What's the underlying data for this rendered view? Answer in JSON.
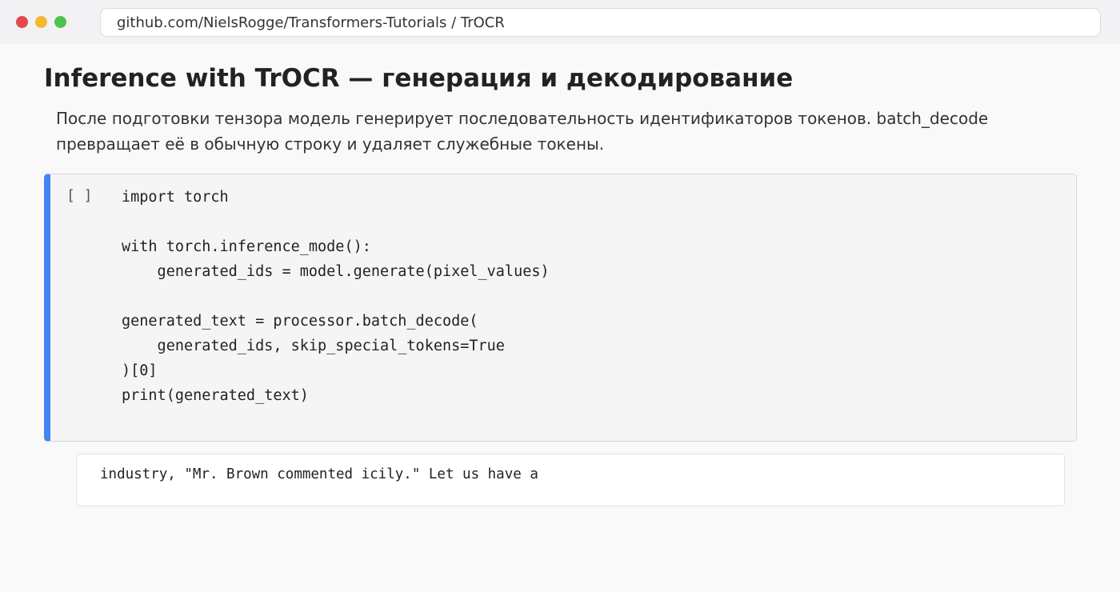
{
  "window": {
    "url": "github.com/NielsRogge/Transformers-Tutorials / TrOCR",
    "controls": [
      "close",
      "minimize",
      "maximize"
    ]
  },
  "notebook": {
    "title": "Inference with TrOCR — генерация и декодирование",
    "description": "После подготовки тензора модель генерирует последовательность идентификаторов токенов. batch_decode превращает её в обычную строку и удаляет служебные токены.",
    "cell": {
      "prompt": "[ ]",
      "code": [
        "import torch",
        "",
        "with torch.inference_mode():",
        "    generated_ids = model.generate(pixel_values)",
        "",
        "generated_text = processor.batch_decode(",
        "    generated_ids, skip_special_tokens=True",
        ")[0]",
        "print(generated_text)"
      ]
    },
    "output": "industry, \"Mr. Brown commented icily.\" Let us have a"
  },
  "colors": {
    "accent": "#4285f4",
    "close": "#e5484d",
    "minimize": "#f4b731",
    "maximize": "#52c150"
  }
}
